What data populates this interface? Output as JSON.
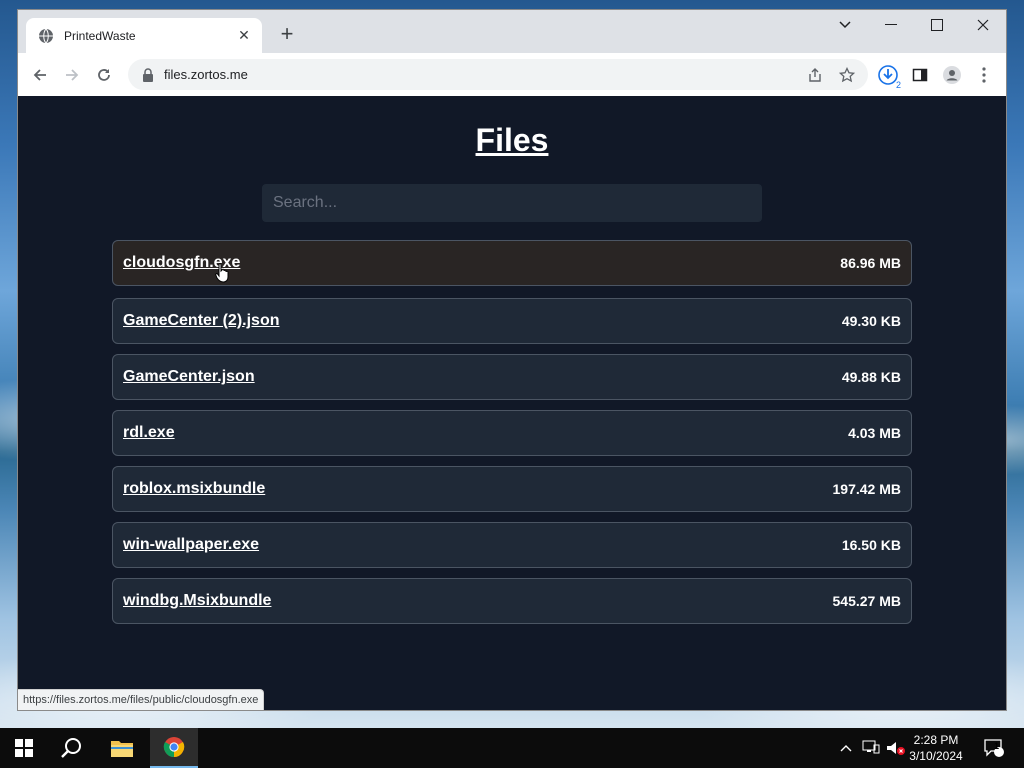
{
  "browser": {
    "tab_title": "PrintedWaste",
    "new_tab_label": "+",
    "url": "files.zortos.me",
    "downloads_badge": "2",
    "status_url": "https://files.zortos.me/files/public/cloudosgfn.exe"
  },
  "page": {
    "title": "Files",
    "search_placeholder": "Search...",
    "files": [
      {
        "name": "cloudosgfn.exe",
        "size": "86.96 MB"
      },
      {
        "name": "GameCenter (2).json",
        "size": "49.30 KB"
      },
      {
        "name": "GameCenter.json",
        "size": "49.88 KB"
      },
      {
        "name": "rdl.exe",
        "size": "4.03 MB"
      },
      {
        "name": "roblox.msixbundle",
        "size": "197.42 MB"
      },
      {
        "name": "win-wallpaper.exe",
        "size": "16.50 KB"
      },
      {
        "name": "windbg.Msixbundle",
        "size": "545.27 MB"
      }
    ]
  },
  "taskbar": {
    "time": "2:28 PM",
    "date": "3/10/2024",
    "notifications_count": "1"
  },
  "colors": {
    "page_bg": "#111827",
    "row_bg": "#1f2937",
    "row_hover_bg": "#292524",
    "row_border": "#4b5563"
  }
}
